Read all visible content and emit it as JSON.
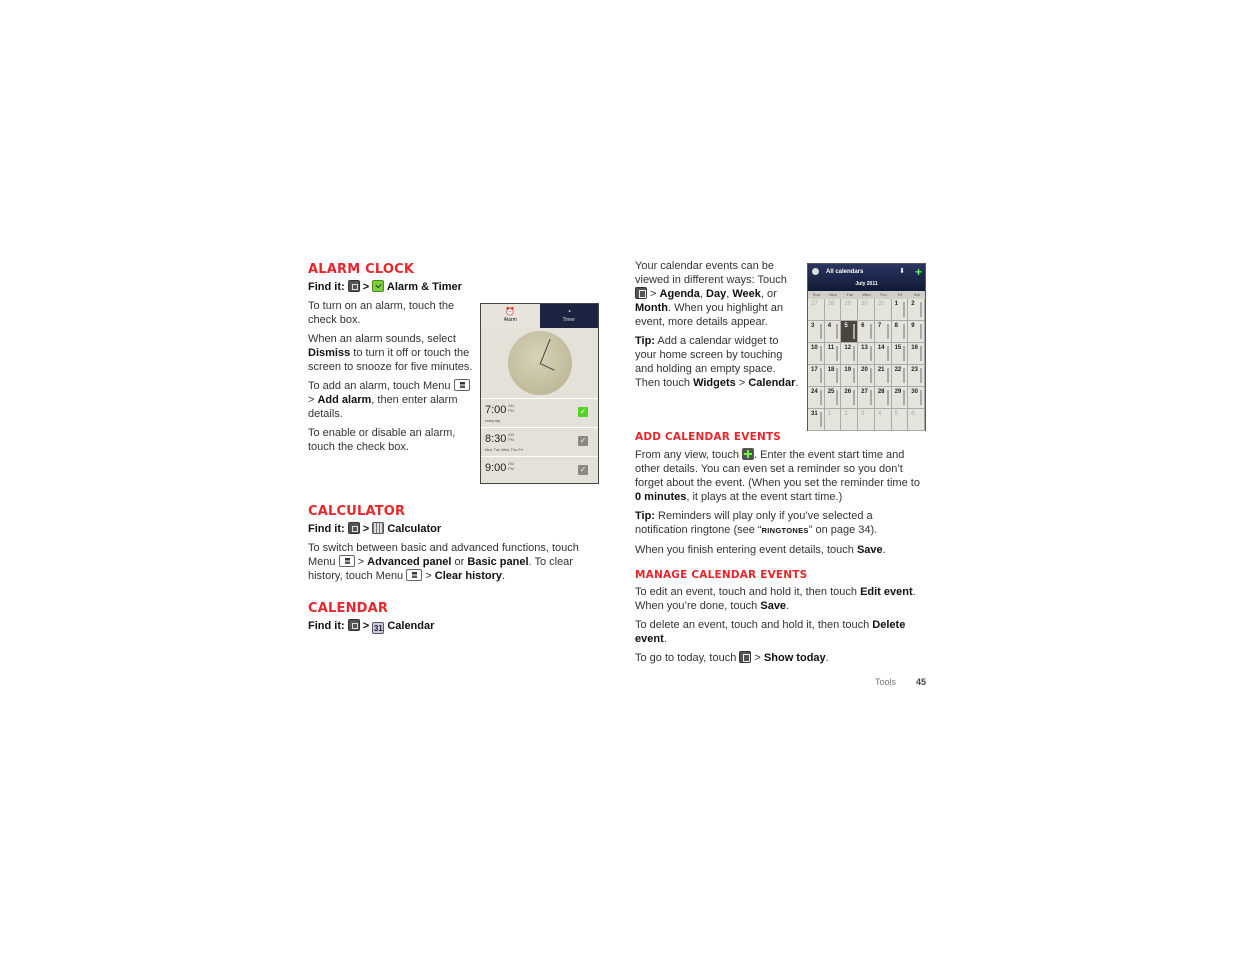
{
  "alarm_clock": {
    "heading": "ALARM CLOCK",
    "find_it": [
      {
        "b": "Find it: "
      },
      {
        "i": "home"
      },
      {
        "t": " > "
      },
      {
        "i": "alarm"
      },
      {
        "b": " Alarm & Timer"
      }
    ],
    "paragraphs": [
      [
        {
          "t": "To turn on an alarm, touch the check box."
        }
      ],
      [
        {
          "t": "When an alarm sounds, select "
        },
        {
          "b": "Dismiss"
        },
        {
          "t": " to turn it off or touch the screen to snooze for five minutes."
        }
      ],
      [
        {
          "t": "To add an alarm, touch Menu "
        },
        {
          "i": "menu"
        },
        {
          "t": " > "
        },
        {
          "b": "Add alarm"
        },
        {
          "t": ", then enter alarm details."
        }
      ],
      [
        {
          "t": "To enable or disable an alarm, touch the check box."
        }
      ]
    ],
    "phone": {
      "tabs": [
        {
          "label": "Alarm",
          "icon": "alarm-clock-icon"
        },
        {
          "label": "Timer",
          "icon": "stopwatch-icon"
        }
      ],
      "am": "AM",
      "pm": "PM",
      "alarms": [
        {
          "time": "7:00",
          "days": "every day",
          "enabled": true
        },
        {
          "time": "8:30",
          "days": "Mon, Tue, Wed, Thu, Fri",
          "enabled": false
        },
        {
          "time": "9:00",
          "days": "",
          "enabled": false
        }
      ]
    }
  },
  "calculator": {
    "heading": "CALCULATOR",
    "find_it": [
      {
        "b": "Find it: "
      },
      {
        "i": "home"
      },
      {
        "t": " > "
      },
      {
        "i": "calc"
      },
      {
        "b": " Calculator"
      }
    ],
    "paragraphs": [
      [
        {
          "t": "To switch between basic and advanced functions, touch Menu "
        },
        {
          "i": "menu"
        },
        {
          "t": " > "
        },
        {
          "b": "Advanced panel"
        },
        {
          "t": " or "
        },
        {
          "b": "Basic panel"
        },
        {
          "t": ". To clear history, touch Menu "
        },
        {
          "i": "menu"
        },
        {
          "t": " > "
        },
        {
          "b": "Clear history"
        },
        {
          "t": "."
        }
      ]
    ]
  },
  "calendar": {
    "heading": "CALENDAR",
    "find_it": [
      {
        "b": "Find it: "
      },
      {
        "i": "home"
      },
      {
        "t": " > "
      },
      {
        "i": "cal"
      },
      {
        "b": " Calendar"
      }
    ],
    "cal_icon_text": "31",
    "intro": [
      [
        {
          "t": "Your calendar events can be viewed in different ways: Touch "
        },
        {
          "i": "calmenu"
        },
        {
          "t": " > "
        },
        {
          "b": "Agenda"
        },
        {
          "t": ", "
        },
        {
          "b": "Day"
        },
        {
          "t": ", "
        },
        {
          "b": "Week"
        },
        {
          "t": ", or "
        },
        {
          "b": "Month"
        },
        {
          "t": ". When you highlight an event, more details appear."
        }
      ],
      [
        {
          "b": "Tip:"
        },
        {
          "t": " Add a calendar widget to your home screen by touching and holding an empty space. Then touch "
        },
        {
          "b": "Widgets"
        },
        {
          "t": " > "
        },
        {
          "b": "Calendar"
        },
        {
          "t": "."
        }
      ]
    ],
    "widget": {
      "title": "All calendars",
      "month": "July 2011",
      "day_names": [
        "Sun",
        "Mon",
        "Tue",
        "Wed",
        "Thu",
        "Fri",
        "Sat"
      ],
      "weeks": [
        [
          "27",
          "28",
          "29",
          "30",
          "31",
          "1",
          "2"
        ],
        [
          "3",
          "4",
          "5",
          "6",
          "7",
          "8",
          "9"
        ],
        [
          "10",
          "11",
          "12",
          "13",
          "14",
          "15",
          "16"
        ],
        [
          "17",
          "18",
          "19",
          "20",
          "21",
          "22",
          "23"
        ],
        [
          "24",
          "25",
          "26",
          "27",
          "28",
          "29",
          "30"
        ],
        [
          "31",
          "1",
          "2",
          "3",
          "4",
          "5",
          "6"
        ]
      ],
      "today": "5"
    }
  },
  "add_events": {
    "heading": "ADD CALENDAR EVENTS",
    "paragraphs": [
      [
        {
          "t": "From any view, touch "
        },
        {
          "i": "plus"
        },
        {
          "t": ". Enter the event start time and other details. You can even set a reminder so you don’t forget about the event. (When you set the reminder time to "
        },
        {
          "b": "0 minutes"
        },
        {
          "t": ", it plays at the event start time.)"
        }
      ],
      [
        {
          "b": "Tip:"
        },
        {
          "t": " Reminders will play only if you’ve selected a notification ringtone (see “"
        },
        {
          "sc": "RINGTONES"
        },
        {
          "t": "” on page 34)."
        }
      ],
      [
        {
          "t": "When you finish entering event details, touch "
        },
        {
          "b": "Save"
        },
        {
          "t": "."
        }
      ]
    ]
  },
  "manage_events": {
    "heading": "MANAGE CALENDAR EVENTS",
    "paragraphs": [
      [
        {
          "t": "To edit an event, touch and hold it, then touch "
        },
        {
          "b": "Edit event"
        },
        {
          "t": ". When you’re done, touch "
        },
        {
          "b": "Save"
        },
        {
          "t": "."
        }
      ],
      [
        {
          "t": "To delete an event, touch and hold it, then touch "
        },
        {
          "b": "Delete event"
        },
        {
          "t": "."
        }
      ],
      [
        {
          "t": "To go to today, touch "
        },
        {
          "i": "calmenu"
        },
        {
          "t": " > "
        },
        {
          "b": "Show today"
        },
        {
          "t": "."
        }
      ]
    ]
  },
  "footer": {
    "section": "Tools",
    "page": "45"
  },
  "colors": {
    "heading": "#e8262b",
    "text": "#333333"
  }
}
